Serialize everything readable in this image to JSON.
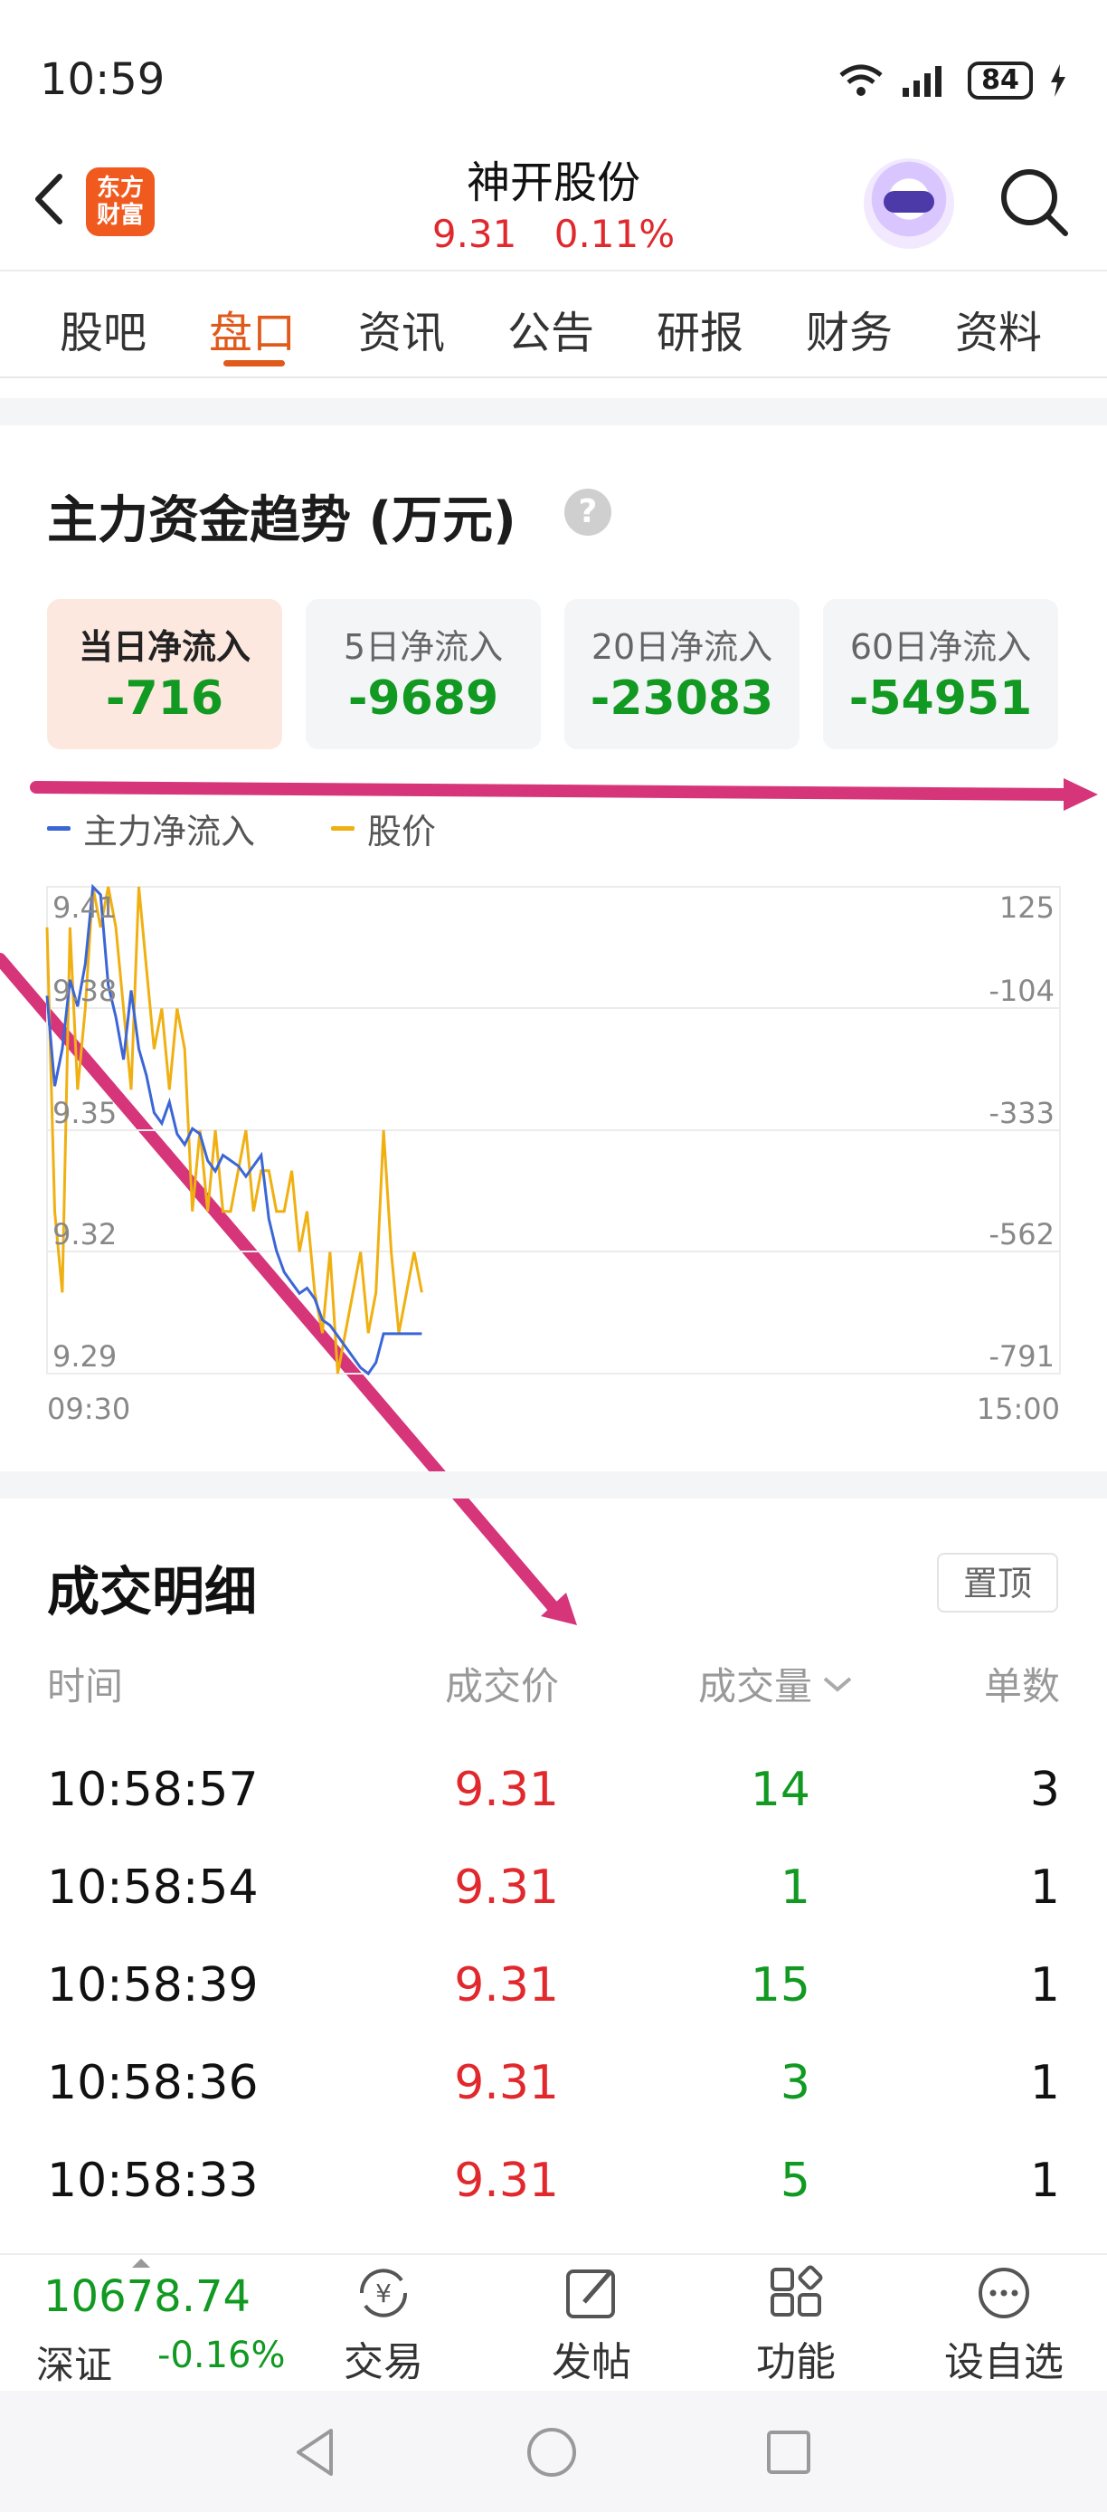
{
  "status_bar": {
    "time": "10:59",
    "battery": "84"
  },
  "header": {
    "logo_text": "东方财富",
    "stock_name": "神开股份",
    "price": "9.31",
    "change_pct": "0.11%"
  },
  "tabs": [
    {
      "label": "股吧"
    },
    {
      "label": "盘口",
      "active": true
    },
    {
      "label": "资讯"
    },
    {
      "label": "公告"
    },
    {
      "label": "研报"
    },
    {
      "label": "财务"
    },
    {
      "label": "资料"
    }
  ],
  "fund_trend": {
    "title": "主力资金趋势 (万元)",
    "help": "?",
    "cards": [
      {
        "label": "当日净流入",
        "value": "-716",
        "active": true
      },
      {
        "label": "5日净流入",
        "value": "-9689"
      },
      {
        "label": "20日净流入",
        "value": "-23083"
      },
      {
        "label": "60日净流入",
        "value": "-54951"
      }
    ]
  },
  "chart_data": {
    "type": "line",
    "series": [
      {
        "name": "主力净流入",
        "color": "#3b66d6"
      },
      {
        "name": "股价",
        "color": "#f0b012"
      }
    ],
    "left_axis_ticks": [
      "9.41",
      "9.38",
      "9.35",
      "9.32",
      "9.29"
    ],
    "right_axis_ticks": [
      "125",
      "-104",
      "-333",
      "-562",
      "-791"
    ],
    "x_ticks": [
      "09:30",
      "15:00"
    ],
    "left_ylim": [
      9.29,
      9.41
    ],
    "right_ylim": [
      -791,
      125
    ],
    "price": [
      9.4,
      9.33,
      9.31,
      9.4,
      9.36,
      9.38,
      9.41,
      9.4,
      9.41,
      9.4,
      9.38,
      9.36,
      9.41,
      9.39,
      9.37,
      9.38,
      9.36,
      9.38,
      9.37,
      9.33,
      9.35,
      9.33,
      9.35,
      9.33,
      9.33,
      9.34,
      9.35,
      9.33,
      9.34,
      9.34,
      9.33,
      9.33,
      9.34,
      9.32,
      9.33,
      9.31,
      9.3,
      9.32,
      9.29,
      9.3,
      9.31,
      9.32,
      9.3,
      9.31,
      9.35,
      9.32,
      9.3,
      9.31,
      9.32,
      9.31
    ],
    "net_inflow": [
      -80,
      -250,
      -180,
      -50,
      -100,
      -20,
      125,
      110,
      -60,
      -120,
      -200,
      -70,
      -180,
      -230,
      -300,
      -320,
      -280,
      -340,
      -360,
      -330,
      -340,
      -390,
      -410,
      -380,
      -390,
      -400,
      -420,
      -400,
      -380,
      -500,
      -560,
      -600,
      -620,
      -640,
      -630,
      -650,
      -690,
      -700,
      -720,
      -740,
      -760,
      -780,
      -791,
      -770,
      -716,
      -716,
      -716,
      -716,
      -716,
      -716
    ],
    "price_points": 50,
    "inflow_points": 50
  },
  "trade_details": {
    "title": "成交明细",
    "pin_label": "置顶",
    "headers": [
      "时间",
      "成交价",
      "成交量",
      "单数"
    ],
    "rows": [
      {
        "time": "10:58:57",
        "price": "9.31",
        "volume": "14",
        "count": "3"
      },
      {
        "time": "10:58:54",
        "price": "9.31",
        "volume": "1",
        "count": "1"
      },
      {
        "time": "10:58:39",
        "price": "9.31",
        "volume": "15",
        "count": "1"
      },
      {
        "time": "10:58:36",
        "price": "9.31",
        "volume": "3",
        "count": "1"
      },
      {
        "time": "10:58:33",
        "price": "9.31",
        "volume": "5",
        "count": "1"
      }
    ]
  },
  "toolbar": {
    "index_value": "10678.74",
    "index_name": "深证",
    "index_change": "-0.16%",
    "items": [
      {
        "label": "交易",
        "icon": "yuan-refresh-icon"
      },
      {
        "label": "发帖",
        "icon": "edit-icon"
      },
      {
        "label": "功能",
        "icon": "grid-icon"
      },
      {
        "label": "设自选",
        "icon": "more-icon"
      }
    ]
  },
  "colors": {
    "accent": "#e05a1c",
    "up": "#e0282d",
    "down": "#119922"
  }
}
